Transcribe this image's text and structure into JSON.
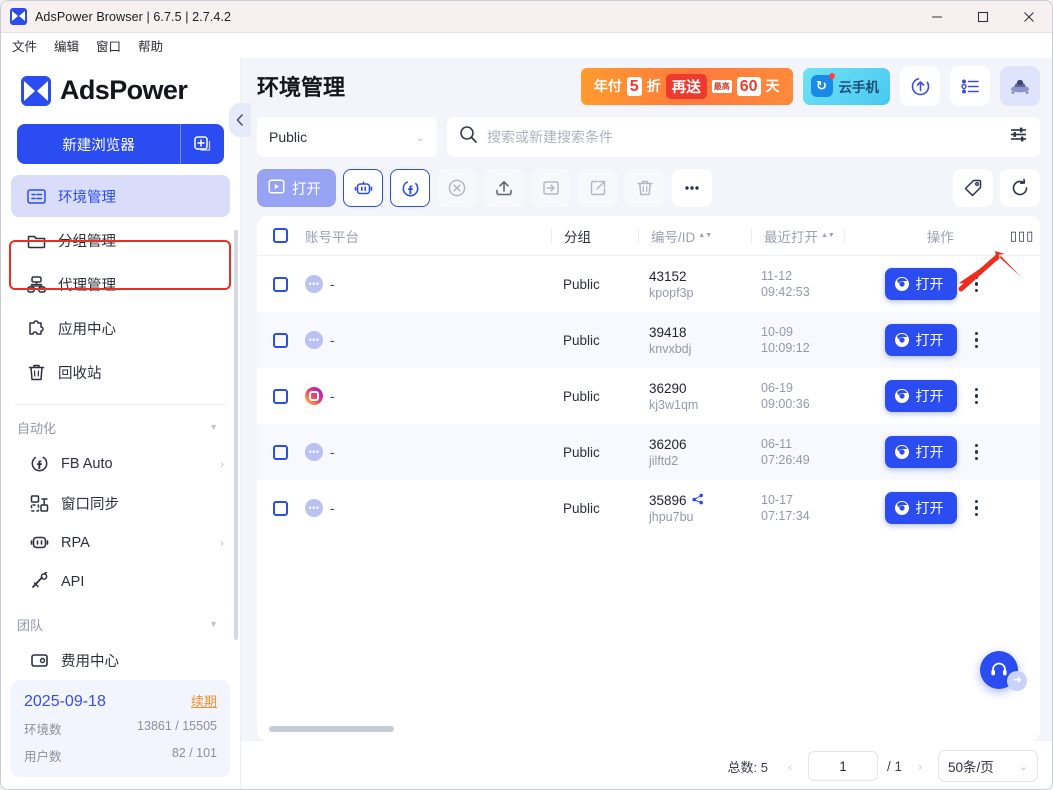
{
  "window": {
    "title": "AdsPower Browser | 6.7.5 | 2.7.4.2",
    "logo_icon": "adspower-logo-icon",
    "controls": {
      "minimize": "minimize-icon",
      "maximize": "maximize-icon",
      "close": "close-icon"
    }
  },
  "menubar": {
    "items": [
      "文件",
      "编辑",
      "窗口",
      "帮助"
    ]
  },
  "sidebar": {
    "brand": "AdsPower",
    "new_browser_label": "新建浏览器",
    "new_browser_plus_icon": "add-window-icon",
    "collapse_icon": "chevron-left-icon",
    "nav": [
      {
        "label": "环境管理",
        "icon": "profiles-icon",
        "active": true
      },
      {
        "label": "分组管理",
        "icon": "folder-icon",
        "active": false
      },
      {
        "label": "代理管理",
        "icon": "proxy-icon",
        "active": false
      },
      {
        "label": "应用中心",
        "icon": "puzzle-icon",
        "active": false
      },
      {
        "label": "回收站",
        "icon": "trash-icon",
        "active": false
      }
    ],
    "groups": [
      {
        "title": "自动化",
        "items": [
          {
            "label": "FB Auto",
            "icon": "facebook-auto-icon",
            "chevron": "›"
          },
          {
            "label": "窗口同步",
            "icon": "window-sync-icon",
            "chevron": ""
          },
          {
            "label": "RPA",
            "icon": "robot-icon",
            "chevron": "›"
          },
          {
            "label": "API",
            "icon": "api-icon",
            "chevron": ""
          }
        ]
      },
      {
        "title": "团队",
        "items": [
          {
            "label": "费用中心",
            "icon": "billing-icon",
            "chevron": ""
          }
        ]
      }
    ],
    "plan": {
      "date": "2025-09-18",
      "renew_label": "续期",
      "rows": [
        {
          "label": "环境数",
          "value": "13861 / 15505"
        },
        {
          "label": "用户数",
          "value": "82 / 101"
        }
      ]
    }
  },
  "header": {
    "page_title": "环境管理",
    "promo": {
      "part1": "年付",
      "discount": "5",
      "part2": "折",
      "pill": "再送",
      "tiny": "最高",
      "days": "60",
      "unit": "天"
    },
    "cloud_phone": {
      "label": "云手机",
      "icon": "cloud-phone-icon"
    },
    "icons": [
      {
        "name": "update-icon",
        "glyph": "↑"
      },
      {
        "name": "checklist-icon",
        "glyph": "☰"
      },
      {
        "name": "avatar-ufo-icon",
        "glyph": "🛸"
      }
    ]
  },
  "filters": {
    "group_select_value": "Public",
    "search_placeholder": "搜索或新建搜索条件",
    "search_value": "",
    "search_icon": "search-icon",
    "filter_icon": "filter-settings-icon"
  },
  "toolbar": {
    "open_label": "打开",
    "open_icon": "open-window-icon",
    "buttons": [
      {
        "name": "rpa-robot-button",
        "icon": "robot-icon"
      },
      {
        "name": "fb-refresh-button",
        "icon": "facebook-refresh-icon"
      },
      {
        "name": "close-browser-button",
        "icon": "close-circle-icon"
      },
      {
        "name": "upload-button",
        "icon": "upload-icon"
      },
      {
        "name": "import-button",
        "icon": "import-folder-icon"
      },
      {
        "name": "export-button",
        "icon": "export-icon"
      },
      {
        "name": "delete-button",
        "icon": "trash-icon"
      },
      {
        "name": "more-button",
        "icon": "more-dots-icon"
      }
    ],
    "right_buttons": [
      {
        "name": "tag-button",
        "icon": "tag-icon"
      },
      {
        "name": "refresh-button",
        "icon": "refresh-icon"
      }
    ]
  },
  "table": {
    "columns": [
      {
        "key": "platform",
        "label": "账号平台",
        "sortable": false
      },
      {
        "key": "group",
        "label": "分组",
        "sortable": false
      },
      {
        "key": "id",
        "label": "编号/ID",
        "sortable": true
      },
      {
        "key": "last_open",
        "label": "最近打开",
        "sortable": true
      },
      {
        "key": "action",
        "label": "操作",
        "sortable": false
      }
    ],
    "column_settings_icon": "column-settings-icon",
    "rows": [
      {
        "platform_icon": "generic-profile-icon",
        "platform": "-",
        "group": "Public",
        "id": "43152",
        "id_sub": "kpopf3p",
        "date": "11-12",
        "time": "09:42:53",
        "has_share_icon": false,
        "open_label": "打开"
      },
      {
        "platform_icon": "generic-profile-icon",
        "platform": "-",
        "group": "Public",
        "id": "39418",
        "id_sub": "knvxbdj",
        "date": "10-09",
        "time": "10:09:12",
        "has_share_icon": false,
        "open_label": "打开"
      },
      {
        "platform_icon": "instagram-icon",
        "platform": "-",
        "group": "Public",
        "id": "36290",
        "id_sub": "kj3w1qm",
        "date": "06-19",
        "time": "09:00:36",
        "has_share_icon": false,
        "open_label": "打开"
      },
      {
        "platform_icon": "generic-profile-icon",
        "platform": "-",
        "group": "Public",
        "id": "36206",
        "id_sub": "jilftd2",
        "date": "06-11",
        "time": "07:26:49",
        "has_share_icon": false,
        "open_label": "打开"
      },
      {
        "platform_icon": "generic-profile-icon",
        "platform": "-",
        "group": "Public",
        "id": "35896",
        "id_sub": "jhpu7bu",
        "date": "10-17",
        "time": "07:17:34",
        "has_share_icon": true,
        "open_label": "打开"
      }
    ]
  },
  "footer": {
    "total_label": "总数: 5",
    "prev_icon": "chevron-left-icon",
    "next_icon": "chevron-right-icon",
    "current_page": "1",
    "page_of": "/ 1",
    "page_size": "50条/页"
  },
  "support": {
    "icon": "headset-support-icon"
  },
  "colors": {
    "primary": "#2b4cf0",
    "highlight": "#ef2d20",
    "accent_orange": "#f09030"
  }
}
